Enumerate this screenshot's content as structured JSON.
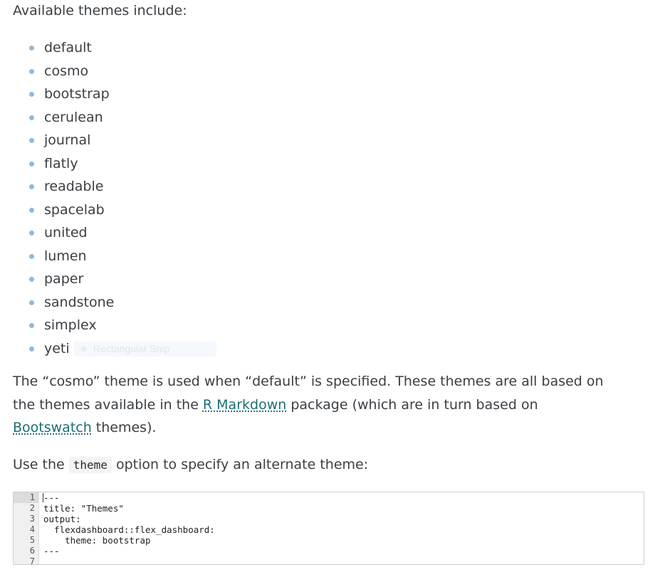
{
  "intro": "Available themes include:",
  "themes": [
    "default",
    "cosmo",
    "bootstrap",
    "cerulean",
    "journal",
    "flatly",
    "readable",
    "spacelab",
    "united",
    "lumen",
    "paper",
    "sandstone",
    "simplex",
    "yeti"
  ],
  "snip_overlay": "Rectangular Snip",
  "paragraph1": {
    "line1": "The “cosmo” theme is used when “default” is specified. These themes are all based on",
    "line2_before": "the themes available in the ",
    "link_rmarkdown": "R Markdown",
    "line2_after": " package (which are in turn based on",
    "link_bootswatch": "Bootswatch",
    "line3_after": " themes)."
  },
  "paragraph2": {
    "before": "Use the ",
    "code": "theme",
    "after": " option to specify an alternate theme:"
  },
  "code_block": {
    "line_numbers": [
      "1",
      "2",
      "3",
      "4",
      "5",
      "6",
      "7"
    ],
    "lines": [
      "---",
      "title: \"Themes\"",
      "output:",
      "  flexdashboard::flex_dashboard:",
      "    theme: bootstrap",
      "---",
      ""
    ]
  },
  "colors": {
    "text": "#3a3f44",
    "bullet": "#8fb9da",
    "link": "#1a6e72",
    "code_bg": "#f4f4f4"
  }
}
